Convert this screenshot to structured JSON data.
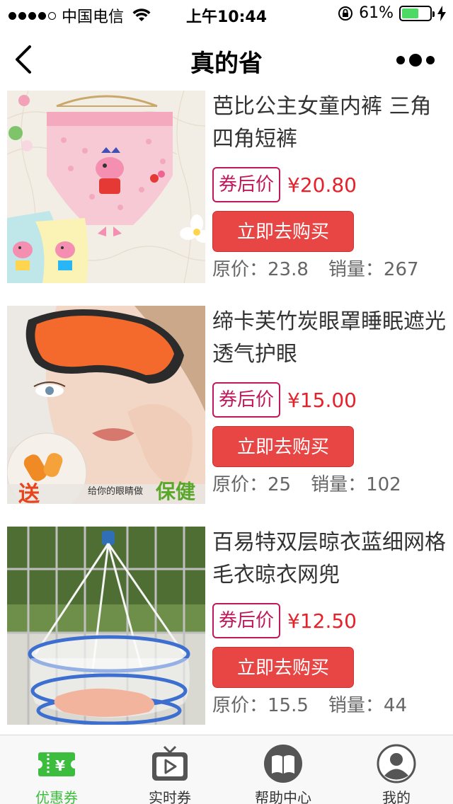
{
  "status_bar": {
    "carrier": "中国电信",
    "time": "上午10:44",
    "battery_percent": "61%",
    "battery_level": 0.61
  },
  "nav": {
    "title": "真的省"
  },
  "products": [
    {
      "title": "芭比公主女童内裤 三角四角短裤",
      "coupon_label": "券后价",
      "price": "¥20.80",
      "buy_label": "立即去购买",
      "orig_price": "原价：23.8",
      "sales": "销量：267"
    },
    {
      "title": "缔卡芙竹炭眼罩睡眠遮光透气护眼",
      "coupon_label": "券后价",
      "price": "¥15.00",
      "buy_label": "立即去购买",
      "orig_price": "原价：25",
      "sales": "销量：102",
      "image_text_promo": "送",
      "image_text_slogan": "给你的眼睛做",
      "image_text_brand": "保健"
    },
    {
      "title": "百易特双层晾衣蓝细网格毛衣晾衣网兜",
      "coupon_label": "券后价",
      "price": "¥12.50",
      "buy_label": "立即去购买",
      "orig_price": "原价：15.5",
      "sales": "销量：44"
    }
  ],
  "tabs": [
    {
      "label": "优惠券",
      "icon": "coupon-icon",
      "active": true
    },
    {
      "label": "实时券",
      "icon": "tv-play-icon",
      "active": false
    },
    {
      "label": "帮助中心",
      "icon": "book-icon",
      "active": false
    },
    {
      "label": "我的",
      "icon": "user-icon",
      "active": false
    }
  ],
  "colors": {
    "accent_green": "#3dbd3d",
    "price_red": "#e8202a",
    "button_red": "#e84545",
    "coupon_magenta": "#c2185b"
  }
}
